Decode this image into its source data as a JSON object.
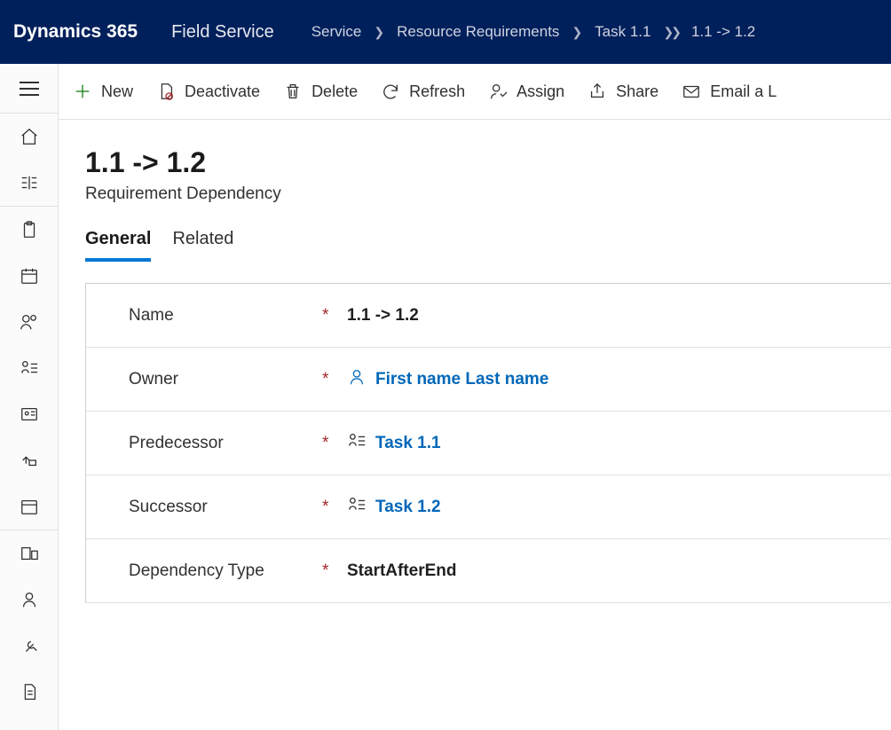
{
  "header": {
    "app_title": "Dynamics 365",
    "app_subtitle": "Field Service",
    "breadcrumb": {
      "area": "Service",
      "parent": "Resource Requirements",
      "record_parent": "Task 1.1",
      "record": "1.1 -> 1.2"
    }
  },
  "commands": {
    "new": "New",
    "deactivate": "Deactivate",
    "delete": "Delete",
    "refresh": "Refresh",
    "assign": "Assign",
    "share": "Share",
    "email": "Email a L"
  },
  "record": {
    "title": "1.1 -> 1.2",
    "entity": "Requirement Dependency"
  },
  "tabs": {
    "general": "General",
    "related": "Related"
  },
  "form": {
    "name": {
      "label": "Name",
      "value": "1.1 -> 1.2"
    },
    "owner": {
      "label": "Owner",
      "value": "First name Last name"
    },
    "predecessor": {
      "label": "Predecessor",
      "value": "Task 1.1"
    },
    "successor": {
      "label": "Successor",
      "value": "Task 1.2"
    },
    "dependency_type": {
      "label": "Dependency Type",
      "value": "StartAfterEnd"
    }
  }
}
